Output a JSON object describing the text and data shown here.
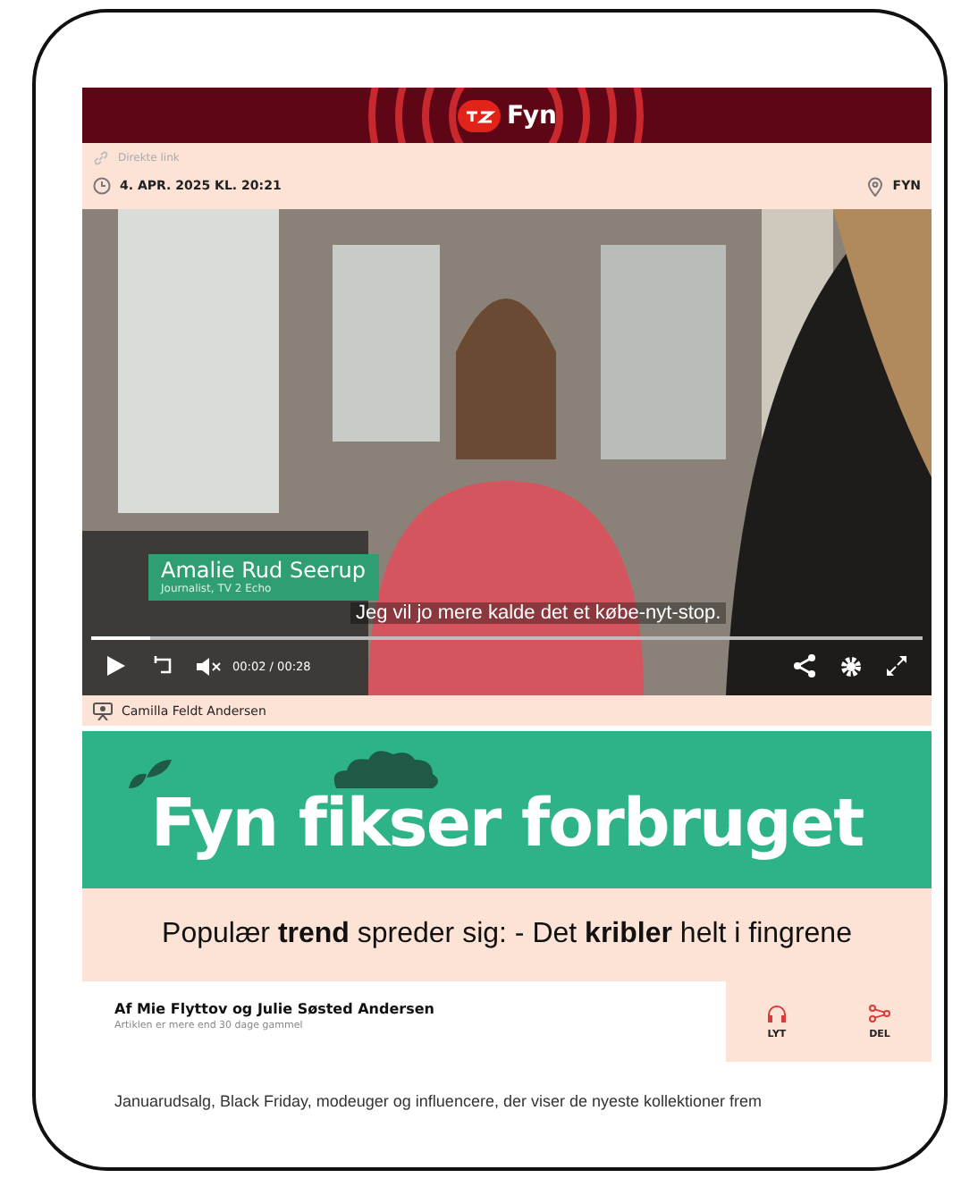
{
  "header": {
    "logo": "Fyn"
  },
  "meta": {
    "link": "Direkte link",
    "date": "4. APR. 2025 KL. 20:21",
    "location": "FYN"
  },
  "video": {
    "lower_third": {
      "name": "Amalie Rud Seerup",
      "role": "Journalist, TV 2 Echo"
    },
    "subtitle": "Jeg vil jo mere kalde det et købe-nyt-stop.",
    "time": "00:02 / 00:28",
    "level": 0.07,
    "muted": true,
    "credit": "Camilla Feldt Andersen"
  },
  "banner": {
    "title": "Fyn fikser forbruget"
  },
  "headline": "Populær **trend** spreder sig: - Det **kribler** helt i fingrene",
  "byline": {
    "authors": "Af Mie Flyttov og Julie Søsted Andersen",
    "note": "Artiklen er mere end 30 dage gammel"
  },
  "actions": [
    {
      "kind": "listen",
      "label": "LYT"
    },
    {
      "kind": "share",
      "label": "DEL"
    }
  ],
  "body": "Januarudsalg, Black Friday, modeuger og influencere, der viser de nyeste kollektioner frem"
}
